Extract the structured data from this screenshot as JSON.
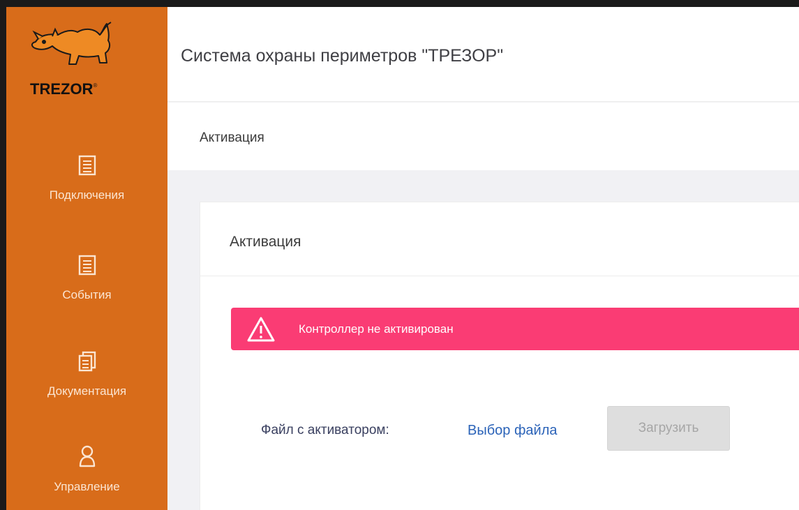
{
  "brand": {
    "name": "TREZOR",
    "mark": "®"
  },
  "header": {
    "title": "Система охраны периметров \"ТРЕЗОР\""
  },
  "breadcrumb": {
    "current": "Активация"
  },
  "sidebar": {
    "items": [
      {
        "label": "Подключения",
        "icon": "list-icon"
      },
      {
        "label": "События",
        "icon": "list-icon"
      },
      {
        "label": "Документация",
        "icon": "documents-icon"
      },
      {
        "label": "Управление",
        "icon": "user-icon"
      }
    ]
  },
  "card": {
    "title": "Активация",
    "alert": {
      "text": "Контроллер не активирован",
      "icon": "warning-icon"
    },
    "file": {
      "label": "Файл с активатором:",
      "choose": "Выбор файла",
      "upload": "Загрузить"
    }
  },
  "colors": {
    "sidebar": "#d86c1a",
    "alert": "#fa3c74",
    "link": "#2b63b8",
    "sidebar_text": "#fbe5d2"
  }
}
